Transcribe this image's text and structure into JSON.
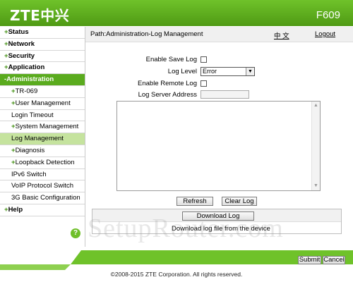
{
  "brand": {
    "logo": "ZTE中兴",
    "model": "F609"
  },
  "sidebar": {
    "items": [
      {
        "label": "Status",
        "level": "top",
        "plus": "+",
        "state": ""
      },
      {
        "label": "Network",
        "level": "top",
        "plus": "+",
        "state": ""
      },
      {
        "label": "Security",
        "level": "top",
        "plus": "+",
        "state": ""
      },
      {
        "label": "Application",
        "level": "top",
        "plus": "+",
        "state": ""
      },
      {
        "label": "Administration",
        "level": "top",
        "plus": "-",
        "state": "active-section"
      },
      {
        "label": "TR-069",
        "level": "sub",
        "plus": "+",
        "state": ""
      },
      {
        "label": "User Management",
        "level": "sub",
        "plus": "+",
        "state": ""
      },
      {
        "label": "Login Timeout",
        "level": "sub",
        "plus": "",
        "state": ""
      },
      {
        "label": "System Management",
        "level": "sub",
        "plus": "+",
        "state": ""
      },
      {
        "label": "Log Management",
        "level": "sub",
        "plus": "",
        "state": "selected"
      },
      {
        "label": "Diagnosis",
        "level": "sub",
        "plus": "+",
        "state": ""
      },
      {
        "label": "Loopback Detection",
        "level": "sub",
        "plus": "+",
        "state": ""
      },
      {
        "label": "IPv6 Switch",
        "level": "sub",
        "plus": "",
        "state": ""
      },
      {
        "label": "VoIP Protocol Switch",
        "level": "sub",
        "plus": "",
        "state": ""
      },
      {
        "label": "3G Basic Configuration",
        "level": "sub",
        "plus": "",
        "state": ""
      },
      {
        "label": "Help",
        "level": "top",
        "plus": "+",
        "state": ""
      }
    ],
    "help_icon": "?"
  },
  "pathbar": {
    "path": "Path:Administration-Log Management",
    "lang": "中 文",
    "logout": "Logout"
  },
  "form": {
    "enable_save_log_label": "Enable Save Log",
    "enable_save_log_checked": false,
    "log_level_label": "Log Level",
    "log_level_value": "Error",
    "enable_remote_log_label": "Enable Remote Log",
    "enable_remote_log_checked": false,
    "log_server_label": "Log Server Address",
    "log_server_value": ""
  },
  "buttons": {
    "refresh": "Refresh",
    "clear_log": "Clear Log",
    "download_log": "Download Log",
    "submit": "Submit",
    "cancel": "Cancel"
  },
  "download": {
    "description": "Download log file from the device"
  },
  "watermark": "SetupRouter.com",
  "footer": {
    "copyright": "©2008-2015 ZTE Corporation. All rights reserved."
  },
  "colors": {
    "brand_green": "#5aab1e",
    "selected_bg": "#c5e39e",
    "header_green": "#6fc22a"
  },
  "icons": {
    "scroll_up": "▲",
    "scroll_down": "▼",
    "select_arrow": "▼"
  }
}
